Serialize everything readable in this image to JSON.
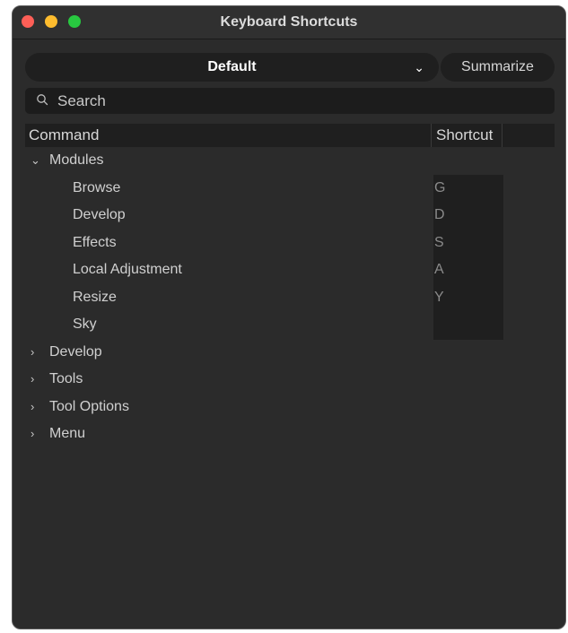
{
  "window": {
    "title": "Keyboard Shortcuts"
  },
  "toolbar": {
    "preset_value": "Default",
    "preset_chevron": "⌄",
    "summarize_label": "Summarize"
  },
  "search": {
    "placeholder": "Search",
    "icon": "search-icon"
  },
  "table": {
    "headers": {
      "command": "Command",
      "shortcut": "Shortcut"
    }
  },
  "tree": {
    "modules": {
      "label": "Modules",
      "expanded": true,
      "chevron": "⌄",
      "children": [
        {
          "label": "Browse",
          "shortcut": "G"
        },
        {
          "label": "Develop",
          "shortcut": "D"
        },
        {
          "label": "Effects",
          "shortcut": "S"
        },
        {
          "label": "Local Adjustment",
          "shortcut": "A"
        },
        {
          "label": "Resize",
          "shortcut": "Y"
        },
        {
          "label": "Sky",
          "shortcut": ""
        }
      ]
    },
    "collapsed": [
      {
        "label": "Develop",
        "chevron": "›"
      },
      {
        "label": "Tools",
        "chevron": "›"
      },
      {
        "label": "Tool Options",
        "chevron": "›"
      },
      {
        "label": "Menu",
        "chevron": "›"
      }
    ]
  },
  "colors": {
    "window_bg": "#2b2b2b",
    "control_bg": "#1f1f1f",
    "close": "#fe5f57",
    "minimize": "#febc2e",
    "maximize": "#28c840"
  }
}
